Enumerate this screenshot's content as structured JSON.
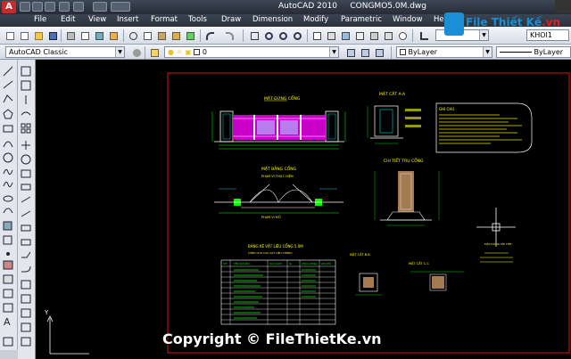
{
  "titlebar": {
    "app_title": "AutoCAD 2010",
    "file_name": "CONGMO5.0M.dwg",
    "logo_label": "A"
  },
  "menubar": {
    "items": [
      "File",
      "Edit",
      "View",
      "Insert",
      "Format",
      "Tools",
      "Draw",
      "Dimension",
      "Modify",
      "Parametric",
      "Window",
      "Help"
    ]
  },
  "toolbar2": {
    "workspace": "AutoCAD Classic",
    "layer_value": "0",
    "color_value": "ByLayer",
    "linetype_value": "ByLayer",
    "text_style_value": "KHOI1"
  },
  "watermark": {
    "logo_text": "File Thiết Kế",
    "logo_domain": ".vn",
    "copyright": "Copyright © FileThietKe.vn"
  },
  "drawing": {
    "view1_title": "MẶT ĐỨNG CỔNG",
    "view2_title": "MẶT CẮT A-A",
    "view3_title": "MẶT BẰNG CỔNG",
    "view3_sub": "PHẠM VI THỰC HIỆN",
    "view3_sub2": "PHẠM VI MỞ",
    "view4_title": "CHI TIẾT TRỤ CỔNG",
    "table_title": "BẢNG KÊ VẬT LIỆU CỔNG 5.0M",
    "table_sub": "(TÍNH CHO CÁC VẬT LIỆU CHÍNH)",
    "notes_title": "GHI CHÚ",
    "detail1_title": "MẶT CẮT B-B",
    "detail2_title": "MẶT CẮT C-C",
    "detail3_title": "MẶT ĐỨNG CHI TIẾT",
    "ucs_y": "Y",
    "table_headers": [
      "STT",
      "TÊN VẬT LIỆU",
      "QUY CÁCH",
      "SL",
      "KHỐI LƯỢNG",
      "GHI CHÚ"
    ]
  }
}
